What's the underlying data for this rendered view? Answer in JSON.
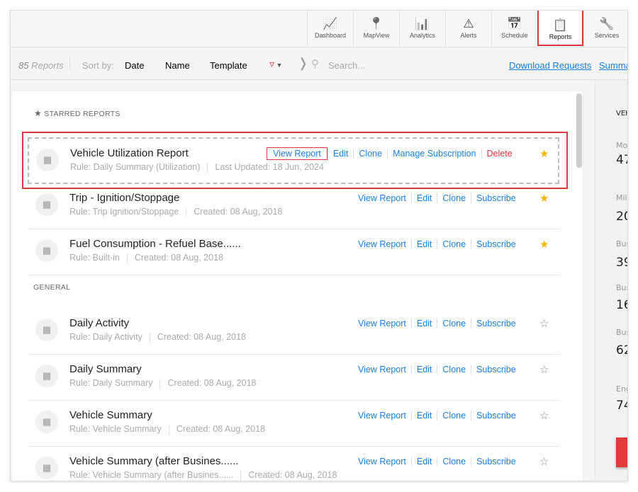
{
  "nav": [
    {
      "label": "Dashboard",
      "icon": "monitor-chart-icon"
    },
    {
      "label": "MapView",
      "icon": "map-pin-icon"
    },
    {
      "label": "Analytics",
      "icon": "bar-chart-icon"
    },
    {
      "label": "Alerts",
      "icon": "alert-icon"
    },
    {
      "label": "Schedule",
      "icon": "calendar-icon"
    },
    {
      "label": "Reports",
      "icon": "clipboard-icon",
      "active": true
    },
    {
      "label": "Services",
      "icon": "tools-icon"
    }
  ],
  "toolbar": {
    "count": "85",
    "count_label": "Reports",
    "sort_by": "Sort by:",
    "sort_options": [
      "Date",
      "Name",
      "Template"
    ],
    "search_placeholder": "Search...",
    "download_requests": "Download Requests",
    "summary": "Summa"
  },
  "starred_header": "STARRED REPORTS",
  "general_header": "GENERAL",
  "starred": [
    {
      "title": "Vehicle Utilization Report",
      "rule": "Rule: Daily Summary (Utilization)",
      "date": "Last Updated: 18 Jun, 2024",
      "actions": [
        "View Report",
        "Edit",
        "Clone",
        "Manage Subscription",
        "Delete"
      ],
      "starred": true
    },
    {
      "title": "Trip - Ignition/Stoppage",
      "rule": "Rule: Trip Ignition/Stoppage",
      "date": "Created: 08 Aug, 2018",
      "actions": [
        "View Report",
        "Edit",
        "Clone",
        "Subscribe"
      ],
      "starred": true
    },
    {
      "title": "Fuel Consumption - Refuel Base......",
      "rule": "Rule: Built-in",
      "date": "Created: 08 Aug, 2018",
      "actions": [
        "View Report",
        "Edit",
        "Clone",
        "Subscribe"
      ],
      "starred": true
    }
  ],
  "general": [
    {
      "title": "Daily Activity",
      "rule": "Rule: Daily Activity",
      "date": "Created: 08 Aug, 2018",
      "actions": [
        "View Report",
        "Edit",
        "Clone",
        "Subscribe"
      ],
      "starred": false
    },
    {
      "title": "Daily Summary",
      "rule": "Rule: Daily Summary",
      "date": "Created: 08 Aug, 2018",
      "actions": [
        "View Report",
        "Edit",
        "Clone",
        "Subscribe"
      ],
      "starred": false
    },
    {
      "title": "Vehicle Summary",
      "rule": "Rule: Vehicle Summary",
      "date": "Created: 08 Aug, 2018",
      "actions": [
        "View Report",
        "Edit",
        "Clone",
        "Subscribe"
      ],
      "starred": false
    },
    {
      "title": "Vehicle Summary (after Busines......",
      "rule": "Rule: Vehicle Summary (after Busines......",
      "date": "Created: 08 Aug, 2018",
      "actions": [
        "View Report",
        "Edit",
        "Clone",
        "Subscribe"
      ],
      "starred": false
    }
  ],
  "right": {
    "header": "VEH",
    "stats": [
      {
        "label": "Mo",
        "value": "47"
      },
      {
        "label": "Mil",
        "value": "20"
      },
      {
        "label": "Bus",
        "value": "39"
      },
      {
        "label": "Bus",
        "value": "16"
      },
      {
        "label": "Bus",
        "value": "62"
      },
      {
        "label": "Eng",
        "value": "74"
      }
    ]
  },
  "colors": {
    "accent": "#1a7fd6",
    "danger": "#d9363e",
    "star": "#f5b301"
  }
}
